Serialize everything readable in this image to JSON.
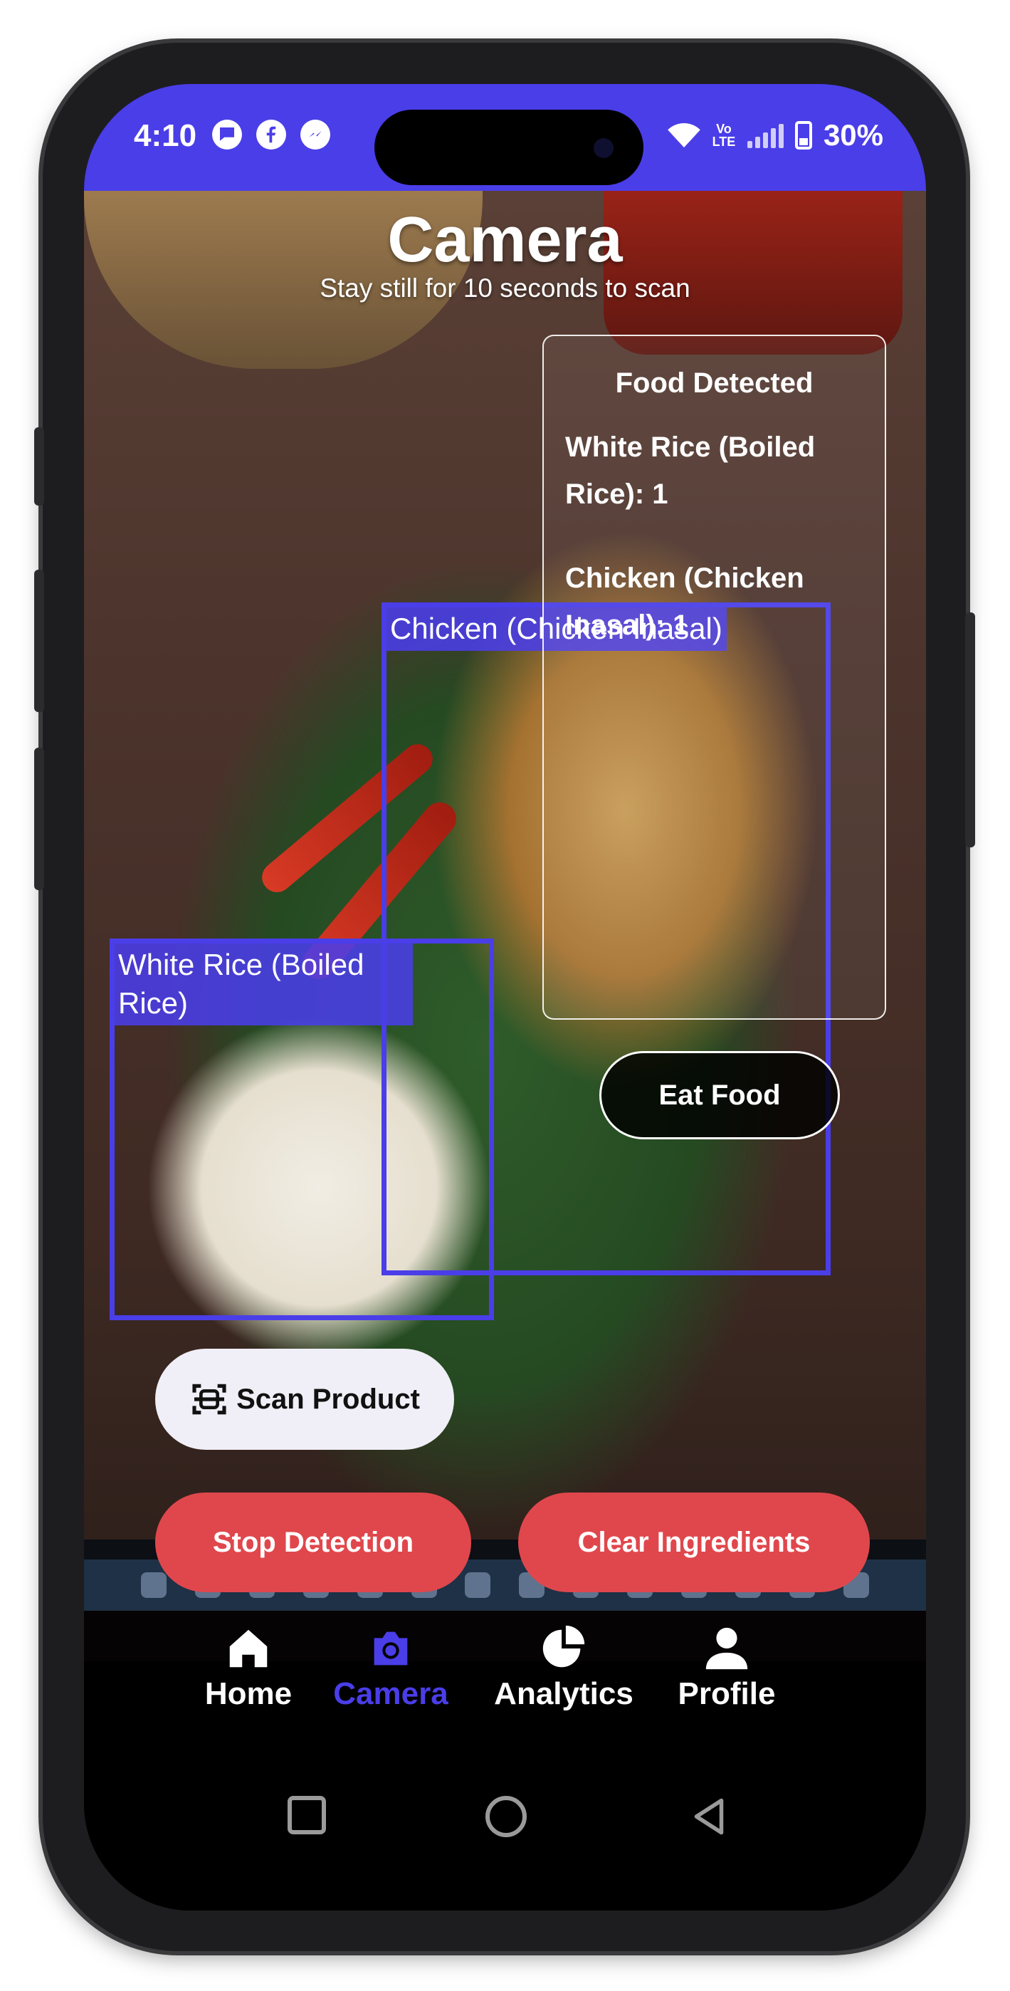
{
  "status_bar": {
    "time": "4:10",
    "notification_icons": [
      "chat-bubble-icon",
      "facebook-icon",
      "messenger-icon",
      "app-icon"
    ],
    "volte_label": "Vo LTE",
    "battery": "30%",
    "background_color": "#4a3ee8"
  },
  "header": {
    "title": "Camera",
    "subtitle": "Stay still for 10 seconds to scan"
  },
  "detections": [
    {
      "label": "Chicken (Chicken Inasal)"
    },
    {
      "label": "White Rice (Boiled Rice)"
    }
  ],
  "food_panel": {
    "title": "Food Detected",
    "items": [
      "White Rice (Boiled Rice): 1",
      "Chicken (Chicken Inasal): 1"
    ]
  },
  "buttons": {
    "eat_food": "Eat Food",
    "scan_product": "Scan Product",
    "stop_detection": "Stop Detection",
    "clear_ingredients": "Clear Ingredients"
  },
  "bottom_nav": {
    "active": "Camera",
    "active_color": "#4a3ee8",
    "items": [
      {
        "label": "Home",
        "icon": "home-icon"
      },
      {
        "label": "Camera",
        "icon": "camera-icon"
      },
      {
        "label": "Analytics",
        "icon": "pie-chart-icon"
      },
      {
        "label": "Profile",
        "icon": "person-icon"
      }
    ]
  },
  "colors": {
    "accent": "#4a3ee8",
    "danger": "#e0474c",
    "scan_button_bg": "#f0eef6"
  }
}
